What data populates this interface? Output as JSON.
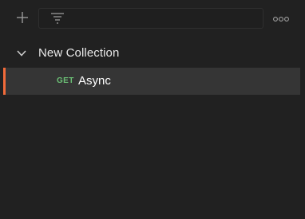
{
  "toolbar": {
    "add_icon": "plus-icon",
    "filter_icon": "filter-icon",
    "filter_placeholder": "",
    "filter_value": "",
    "more_icon": "more-horizontal-icon"
  },
  "collections": [
    {
      "name": "New Collection",
      "expanded": true,
      "requests": [
        {
          "method": "GET",
          "name": "Async",
          "active": true
        }
      ]
    }
  ],
  "colors": {
    "background": "#212121",
    "selected_row": "#353535",
    "active_marker": "#f26b3a",
    "get_method": "#6bbf75"
  }
}
